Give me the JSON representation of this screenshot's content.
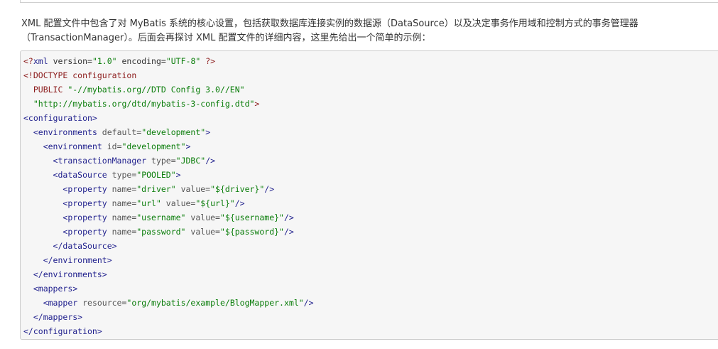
{
  "intro": {
    "line1": "XML 配置文件中包含了对 MyBatis 系统的核心设置，包括获取数据库连接实例的数据源（DataSource）以及决定事务作用域和控制方式的事务管理器",
    "line2": "（TransactionManager）。后面会再探讨 XML 配置文件的详细内容，这里先给出一个简单的示例："
  },
  "code": {
    "language": "xml",
    "lines": [
      [
        {
          "t": "pi",
          "v": "<?"
        },
        {
          "t": "tag",
          "v": "xml"
        },
        {
          "t": "plain",
          "v": " version="
        },
        {
          "t": "str",
          "v": "\"1.0\""
        },
        {
          "t": "plain",
          "v": " encoding="
        },
        {
          "t": "str",
          "v": "\"UTF-8\""
        },
        {
          "t": "plain",
          "v": " "
        },
        {
          "t": "pi",
          "v": "?>"
        }
      ],
      [
        {
          "t": "doctype",
          "v": "<!DOCTYPE configuration"
        }
      ],
      [
        {
          "t": "doctype",
          "v": "  PUBLIC "
        },
        {
          "t": "str",
          "v": "\"-//mybatis.org//DTD Config 3.0//EN\""
        }
      ],
      [
        {
          "t": "doctype",
          "v": "  "
        },
        {
          "t": "str",
          "v": "\"http://mybatis.org/dtd/mybatis-3-config.dtd\""
        },
        {
          "t": "doctype",
          "v": ">"
        }
      ],
      [
        {
          "t": "tag",
          "v": "<configuration>"
        }
      ],
      [
        {
          "t": "plain",
          "v": "  "
        },
        {
          "t": "tag",
          "v": "<environments"
        },
        {
          "t": "attr",
          "v": " default="
        },
        {
          "t": "str",
          "v": "\"development\""
        },
        {
          "t": "tag",
          "v": ">"
        }
      ],
      [
        {
          "t": "plain",
          "v": "    "
        },
        {
          "t": "tag",
          "v": "<environment"
        },
        {
          "t": "attr",
          "v": " id="
        },
        {
          "t": "str",
          "v": "\"development\""
        },
        {
          "t": "tag",
          "v": ">"
        }
      ],
      [
        {
          "t": "plain",
          "v": "      "
        },
        {
          "t": "tag",
          "v": "<transactionManager"
        },
        {
          "t": "attr",
          "v": " type="
        },
        {
          "t": "str",
          "v": "\"JDBC\""
        },
        {
          "t": "tag",
          "v": "/>"
        }
      ],
      [
        {
          "t": "plain",
          "v": "      "
        },
        {
          "t": "tag",
          "v": "<dataSource"
        },
        {
          "t": "attr",
          "v": " type="
        },
        {
          "t": "str",
          "v": "\"POOLED\""
        },
        {
          "t": "tag",
          "v": ">"
        }
      ],
      [
        {
          "t": "plain",
          "v": "        "
        },
        {
          "t": "tag",
          "v": "<property"
        },
        {
          "t": "attr",
          "v": " name="
        },
        {
          "t": "str",
          "v": "\"driver\""
        },
        {
          "t": "attr",
          "v": " value="
        },
        {
          "t": "str",
          "v": "\"${driver}\""
        },
        {
          "t": "tag",
          "v": "/>"
        }
      ],
      [
        {
          "t": "plain",
          "v": "        "
        },
        {
          "t": "tag",
          "v": "<property"
        },
        {
          "t": "attr",
          "v": " name="
        },
        {
          "t": "str",
          "v": "\"url\""
        },
        {
          "t": "attr",
          "v": " value="
        },
        {
          "t": "str",
          "v": "\"${url}\""
        },
        {
          "t": "tag",
          "v": "/>"
        }
      ],
      [
        {
          "t": "plain",
          "v": "        "
        },
        {
          "t": "tag",
          "v": "<property"
        },
        {
          "t": "attr",
          "v": " name="
        },
        {
          "t": "str",
          "v": "\"username\""
        },
        {
          "t": "attr",
          "v": " value="
        },
        {
          "t": "str",
          "v": "\"${username}\""
        },
        {
          "t": "tag",
          "v": "/>"
        }
      ],
      [
        {
          "t": "plain",
          "v": "        "
        },
        {
          "t": "tag",
          "v": "<property"
        },
        {
          "t": "attr",
          "v": " name="
        },
        {
          "t": "str",
          "v": "\"password\""
        },
        {
          "t": "attr",
          "v": " value="
        },
        {
          "t": "str",
          "v": "\"${password}\""
        },
        {
          "t": "tag",
          "v": "/>"
        }
      ],
      [
        {
          "t": "plain",
          "v": "      "
        },
        {
          "t": "tag",
          "v": "</dataSource>"
        }
      ],
      [
        {
          "t": "plain",
          "v": "    "
        },
        {
          "t": "tag",
          "v": "</environment>"
        }
      ],
      [
        {
          "t": "plain",
          "v": "  "
        },
        {
          "t": "tag",
          "v": "</environments>"
        }
      ],
      [
        {
          "t": "plain",
          "v": "  "
        },
        {
          "t": "tag",
          "v": "<mappers>"
        }
      ],
      [
        {
          "t": "plain",
          "v": "    "
        },
        {
          "t": "tag",
          "v": "<mapper"
        },
        {
          "t": "attr",
          "v": " resource="
        },
        {
          "t": "str",
          "v": "\"org/mybatis/example/BlogMapper.xml\""
        },
        {
          "t": "tag",
          "v": "/>"
        }
      ],
      [
        {
          "t": "plain",
          "v": "  "
        },
        {
          "t": "tag",
          "v": "</mappers>"
        }
      ],
      [
        {
          "t": "tag",
          "v": "</configuration>"
        }
      ]
    ]
  },
  "colors": {
    "tag": "#1e1e8c",
    "string": "#0a7d0a",
    "attribute": "#555555",
    "doctype": "#8b1a1a",
    "code_background": "#f6f6f6"
  }
}
